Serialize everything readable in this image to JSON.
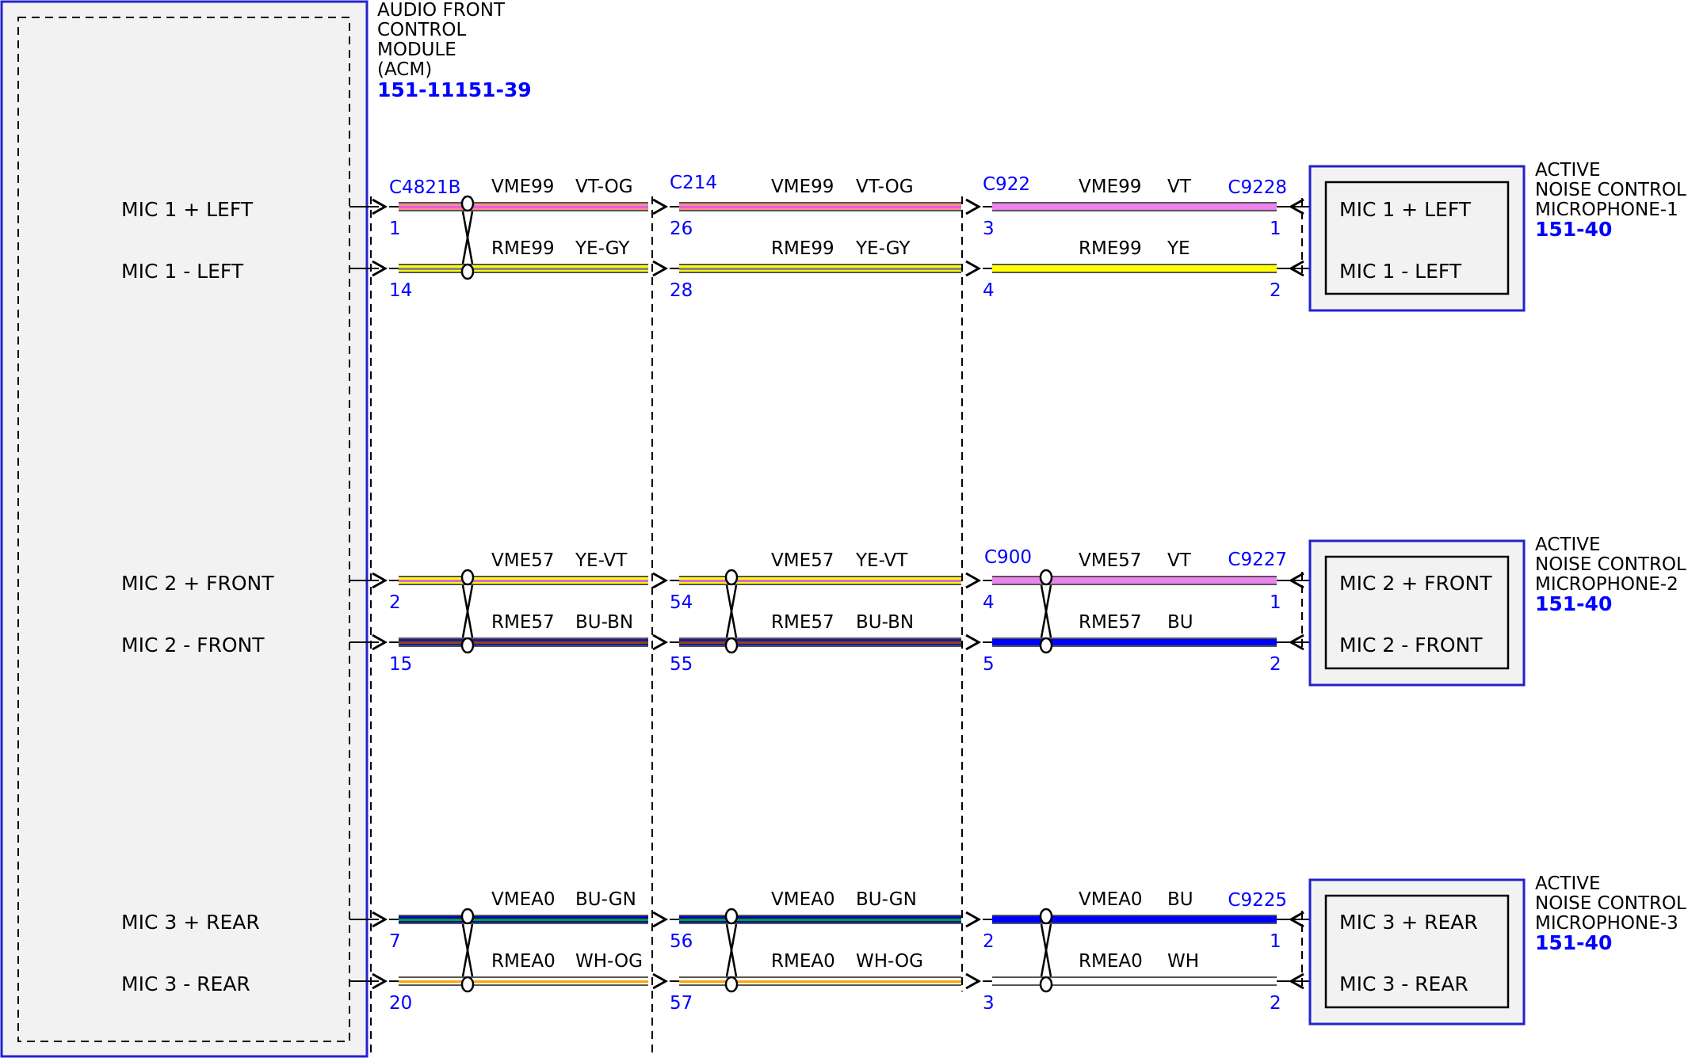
{
  "colors": {
    "module_border": "#2222cc",
    "module_fill": "#f2f2f2",
    "blue_text": "#0000ff",
    "wire_codes": {
      "VT-OG": [
        "#ff8a8a",
        "#dd66dd"
      ],
      "YE-GY": [
        "#ffff00",
        "#888888"
      ],
      "VT": [
        "#ee82ee",
        "#ee82ee"
      ],
      "YE": [
        "#ffff00",
        "#ffff00"
      ],
      "YE-VT": [
        "#ffff00",
        "#dd66dd"
      ],
      "BU-BN": [
        "#1a1aa0",
        "#8b4513"
      ],
      "BU": [
        "#0000ff",
        "#0000ff"
      ],
      "BU-GN": [
        "#0000cc",
        "#00aa00"
      ],
      "WH-OG": [
        "#ffffff",
        "#ffa500"
      ],
      "WH": [
        "#ffffff",
        "#ffffff"
      ]
    }
  },
  "acm": {
    "title_lines": [
      "AUDIO FRONT",
      "CONTROL",
      "MODULE",
      "(ACM)"
    ],
    "ref": "151-11151-39",
    "pins": [
      "MIC 1 + LEFT",
      "MIC 1 - LEFT",
      "MIC 2 + FRONT",
      "MIC 2 - FRONT",
      "MIC 3 + REAR",
      "MIC 3 - REAR"
    ]
  },
  "connectors": {
    "acm_side": "C4821B",
    "inline_1": "C214",
    "inline_2_group_1": "C922",
    "inline_2_group_2": "C900",
    "mic_1": "C9228",
    "mic_2": "C9227",
    "mic_3": "C9225"
  },
  "microphones": [
    {
      "title_lines": [
        "ACTIVE",
        "NOISE CONTROL",
        "MICROPHONE-1"
      ],
      "ref": "151-40",
      "pins": [
        "MIC 1 + LEFT",
        "MIC 1 - LEFT"
      ]
    },
    {
      "title_lines": [
        "ACTIVE",
        "NOISE CONTROL",
        "MICROPHONE-2"
      ],
      "ref": "151-40",
      "pins": [
        "MIC 2 + FRONT",
        "MIC 2 - FRONT"
      ]
    },
    {
      "title_lines": [
        "ACTIVE",
        "NOISE CONTROL",
        "MICROPHONE-3"
      ],
      "ref": "151-40",
      "pins": [
        "MIC 3 + REAR",
        "MIC 3 - REAR"
      ]
    }
  ],
  "wires": [
    {
      "segments": [
        {
          "circuit": "VME99",
          "color": "VT-OG",
          "pin": "1"
        },
        {
          "circuit": "VME99",
          "color": "VT-OG",
          "pin": "26"
        },
        {
          "circuit": "VME99",
          "color": "VT",
          "pin": "3",
          "end_pin": "1"
        }
      ]
    },
    {
      "segments": [
        {
          "circuit": "RME99",
          "color": "YE-GY",
          "pin": "14"
        },
        {
          "circuit": "RME99",
          "color": "YE-GY",
          "pin": "28"
        },
        {
          "circuit": "RME99",
          "color": "YE",
          "pin": "4",
          "end_pin": "2"
        }
      ]
    },
    {
      "segments": [
        {
          "circuit": "VME57",
          "color": "YE-VT",
          "pin": "2"
        },
        {
          "circuit": "VME57",
          "color": "YE-VT",
          "pin": "54"
        },
        {
          "circuit": "VME57",
          "color": "VT",
          "pin": "4",
          "end_pin": "1"
        }
      ]
    },
    {
      "segments": [
        {
          "circuit": "RME57",
          "color": "BU-BN",
          "pin": "15"
        },
        {
          "circuit": "RME57",
          "color": "BU-BN",
          "pin": "55"
        },
        {
          "circuit": "RME57",
          "color": "BU",
          "pin": "5",
          "end_pin": "2"
        }
      ]
    },
    {
      "segments": [
        {
          "circuit": "VMEA0",
          "color": "BU-GN",
          "pin": "7"
        },
        {
          "circuit": "VMEA0",
          "color": "BU-GN",
          "pin": "56"
        },
        {
          "circuit": "VMEA0",
          "color": "BU",
          "pin": "2",
          "end_pin": "1"
        }
      ]
    },
    {
      "segments": [
        {
          "circuit": "RMEA0",
          "color": "WH-OG",
          "pin": "20"
        },
        {
          "circuit": "RMEA0",
          "color": "WH-OG",
          "pin": "57"
        },
        {
          "circuit": "RMEA0",
          "color": "WH",
          "pin": "3",
          "end_pin": "2"
        }
      ]
    }
  ]
}
